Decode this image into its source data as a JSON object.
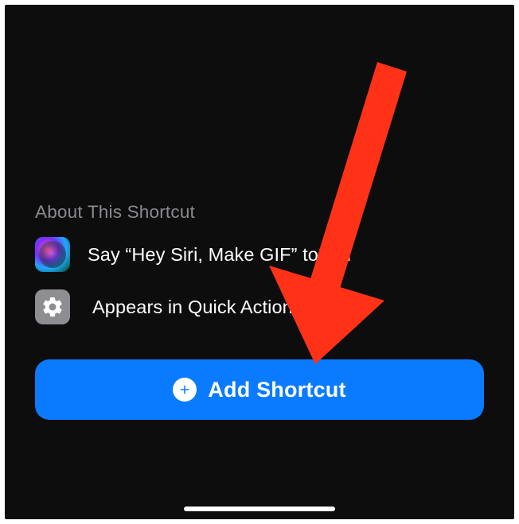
{
  "section": {
    "header": "About This Shortcut",
    "rows": [
      {
        "icon": "siri-icon",
        "text": "Say “Hey Siri, Make GIF” to run"
      },
      {
        "icon": "gear-icon",
        "text": "Appears in Quick Actions on Mac"
      }
    ]
  },
  "button": {
    "label": "Add Shortcut"
  },
  "overlay": {
    "arrow_color": "#ff3217"
  }
}
